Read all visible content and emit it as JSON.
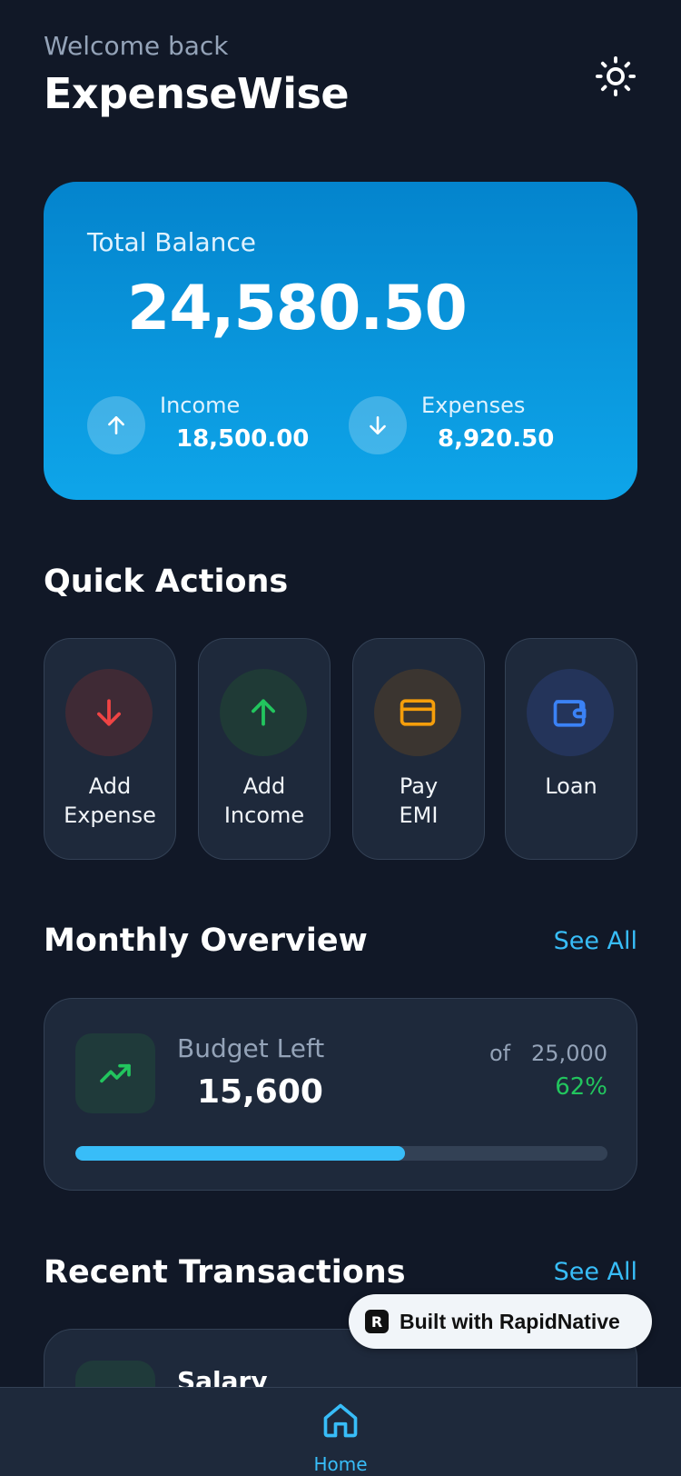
{
  "header": {
    "welcome": "Welcome back",
    "title": "ExpenseWise",
    "theme_icon": "sun-icon"
  },
  "balance": {
    "label": "Total Balance",
    "amount": "24,580.50",
    "income": {
      "label": "Income",
      "value": "18,500.00",
      "icon": "arrow-up-icon"
    },
    "expenses": {
      "label": "Expenses",
      "value": "8,920.50",
      "icon": "arrow-down-icon"
    },
    "gradient_top": "#0484cd",
    "gradient_bottom": "#0ea5e9"
  },
  "quick_actions": {
    "title": "Quick Actions",
    "items": [
      {
        "label": "Add\nExpense",
        "icon": "arrow-down-icon",
        "color": "#ef4444",
        "bg": "#3f2a35"
      },
      {
        "label": "Add\nIncome",
        "icon": "arrow-up-icon",
        "color": "#22c55e",
        "bg": "#1f3a36"
      },
      {
        "label": "Pay\nEMI",
        "icon": "credit-card-icon",
        "color": "#f59e0b",
        "bg": "#3b3530"
      },
      {
        "label": "Loan",
        "icon": "wallet-icon",
        "color": "#3b82f6",
        "bg": "#24345a"
      }
    ]
  },
  "monthly_overview": {
    "title": "Monthly Overview",
    "see_all": "See All",
    "icon": "trending-up-icon",
    "label": "Budget Left",
    "amount": "15,600",
    "of_text": "of   25,000",
    "percent": "62%",
    "progress": 0.62
  },
  "recent_transactions": {
    "title": "Recent Transactions",
    "see_all": "See All",
    "items": [
      {
        "title": "Salary"
      }
    ]
  },
  "badge": {
    "text": "Built with RapidNative",
    "logo": "R"
  },
  "nav": {
    "home_label": "Home",
    "home_icon": "home-icon"
  },
  "colors": {
    "background": "#111827",
    "card": "#1e293b",
    "accent": "#38bdf8",
    "positive": "#22c55e"
  }
}
